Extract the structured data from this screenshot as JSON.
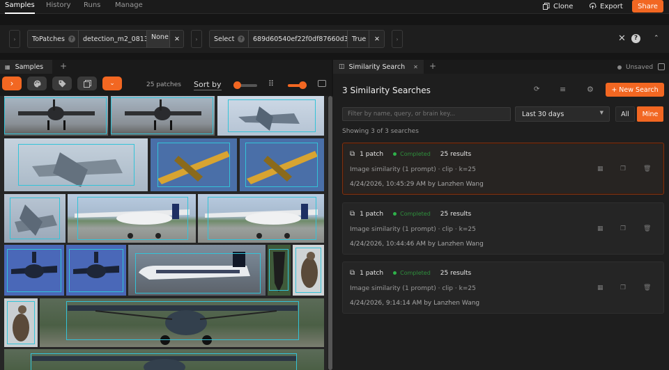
{
  "topnav": {
    "tabs": [
      "Samples",
      "History",
      "Runs",
      "Manage"
    ],
    "clone_label": "Clone",
    "export_label": "Export",
    "share_label": "Share"
  },
  "view_bar": {
    "stages": [
      {
        "name": "ToPatches",
        "value": "detection_m2_0813",
        "extra": "None"
      },
      {
        "name": "Select",
        "value": "689d60540ef22f0df87660d3...",
        "extra": "True"
      }
    ]
  },
  "left_panel": {
    "tab_label": "Samples",
    "patch_count": "25 patches",
    "sort_label": "Sort by"
  },
  "right_panel": {
    "tab_label": "Similarity Search",
    "unsaved_label": "Unsaved",
    "title": "3 Similarity Searches",
    "new_search_label": "+ New Search",
    "filter_placeholder": "Filter by name, query, or brain key...",
    "date_range": "Last 30 days",
    "all_label": "All",
    "mine_label": "Mine",
    "showing": "Showing 3 of 3 searches",
    "searches": [
      {
        "patch": "1 patch",
        "status": "Completed",
        "results": "25 results",
        "description": "Image similarity (1 prompt) · clip · k=25",
        "timestamp": "4/24/2026, 10:45:29 AM by Lanzhen Wang",
        "selected": true
      },
      {
        "patch": "1 patch",
        "status": "Completed",
        "results": "25 results",
        "description": "Image similarity (1 prompt) · clip · k=25",
        "timestamp": "4/24/2026, 10:44:46 AM by Lanzhen Wang",
        "selected": false
      },
      {
        "patch": "1 patch",
        "status": "Completed",
        "results": "25 results",
        "description": "Image similarity (1 prompt) · clip · k=25",
        "timestamp": "4/24/2026, 9:14:14 AM by Lanzhen Wang",
        "selected": false
      }
    ]
  },
  "colors": {
    "accent": "#f26722",
    "patch_box": "#33c3d8",
    "status_green": "#2fb14a"
  }
}
